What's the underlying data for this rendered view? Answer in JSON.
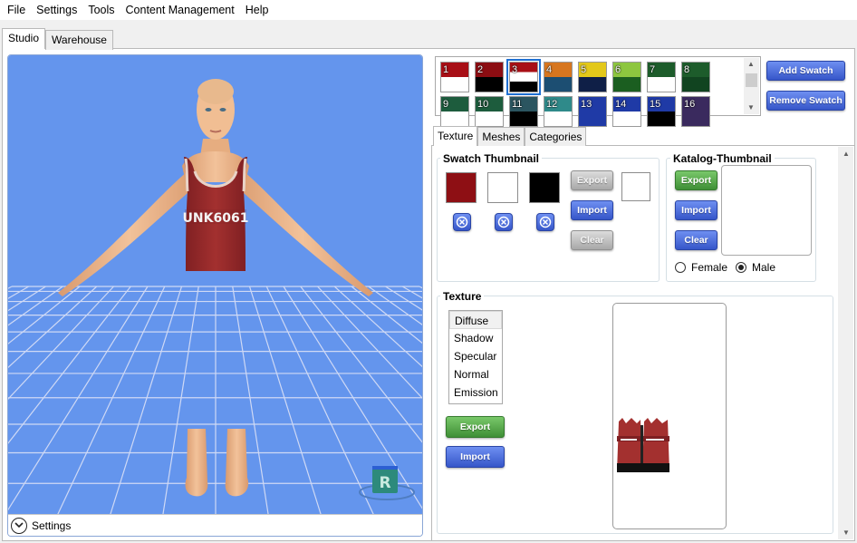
{
  "menu": [
    "File",
    "Settings",
    "Tools",
    "Content Management",
    "Help"
  ],
  "main_tabs": [
    {
      "label": "Studio",
      "active": true
    },
    {
      "label": "Warehouse",
      "active": false
    }
  ],
  "viewport": {
    "settings_label": "Settings",
    "sky_color": "#6495ed",
    "gizmo_letter": "R"
  },
  "swatches": [
    {
      "num": "1",
      "top": "#a80f16",
      "bottom": "#ffffff"
    },
    {
      "num": "2",
      "top": "#8c0d12",
      "bottom": "#000000"
    },
    {
      "num": "3",
      "top": "#a80f16",
      "mid": "#ffffff",
      "bottom": "#000000",
      "selected": true
    },
    {
      "num": "4",
      "top": "#d7761f",
      "bottom": "#1c4e72"
    },
    {
      "num": "5",
      "top": "#e3c81a",
      "bottom": "#0f1f47"
    },
    {
      "num": "6",
      "top": "#8dc63f",
      "bottom": "#1b5e20"
    },
    {
      "num": "7",
      "top": "#1d5c2b",
      "bottom": "#ffffff"
    },
    {
      "num": "8",
      "top": "#1d5c2b",
      "bottom": "#114420"
    },
    {
      "num": "9",
      "top": "#1d5c3d",
      "bottom": "#ffffff"
    },
    {
      "num": "10",
      "top": "#1d5c3d",
      "bottom": "#ffffff"
    },
    {
      "num": "11",
      "top": "#2b5560",
      "bottom": "#000000"
    },
    {
      "num": "12",
      "top": "#2f8a8a",
      "bottom": "#ffffff"
    },
    {
      "num": "13",
      "top": "#1f3aa6",
      "bottom": "#1f3aa6"
    },
    {
      "num": "14",
      "top": "#1f3aa6",
      "bottom": "#ffffff"
    },
    {
      "num": "15",
      "top": "#1f3aa6",
      "bottom": "#000000"
    },
    {
      "num": "16",
      "top": "#3a2a5e",
      "bottom": "#3a2a5e"
    }
  ],
  "swatch_buttons": {
    "add": "Add Swatch",
    "remove": "Remove Swatch"
  },
  "sub_tabs": [
    {
      "label": "Texture",
      "active": true
    },
    {
      "label": "Meshes",
      "active": false
    },
    {
      "label": "Categories",
      "active": false
    }
  ],
  "swatch_thumbnail": {
    "title": "Swatch Thumbnail",
    "colors": [
      "#8e0f14",
      "#ffffff",
      "#000000"
    ],
    "export": "Export",
    "import": "Import",
    "clear": "Clear"
  },
  "katalog_thumbnail": {
    "title": "Katalog-Thumbnail",
    "export": "Export",
    "import": "Import",
    "clear": "Clear",
    "genders": [
      {
        "label": "Female",
        "checked": false
      },
      {
        "label": "Male",
        "checked": true
      }
    ]
  },
  "texture": {
    "title": "Texture",
    "items": [
      "Diffuse",
      "Shadow",
      "Specular",
      "Normal",
      "Emission"
    ],
    "selected": "Diffuse",
    "export": "Export",
    "import": "Import"
  }
}
